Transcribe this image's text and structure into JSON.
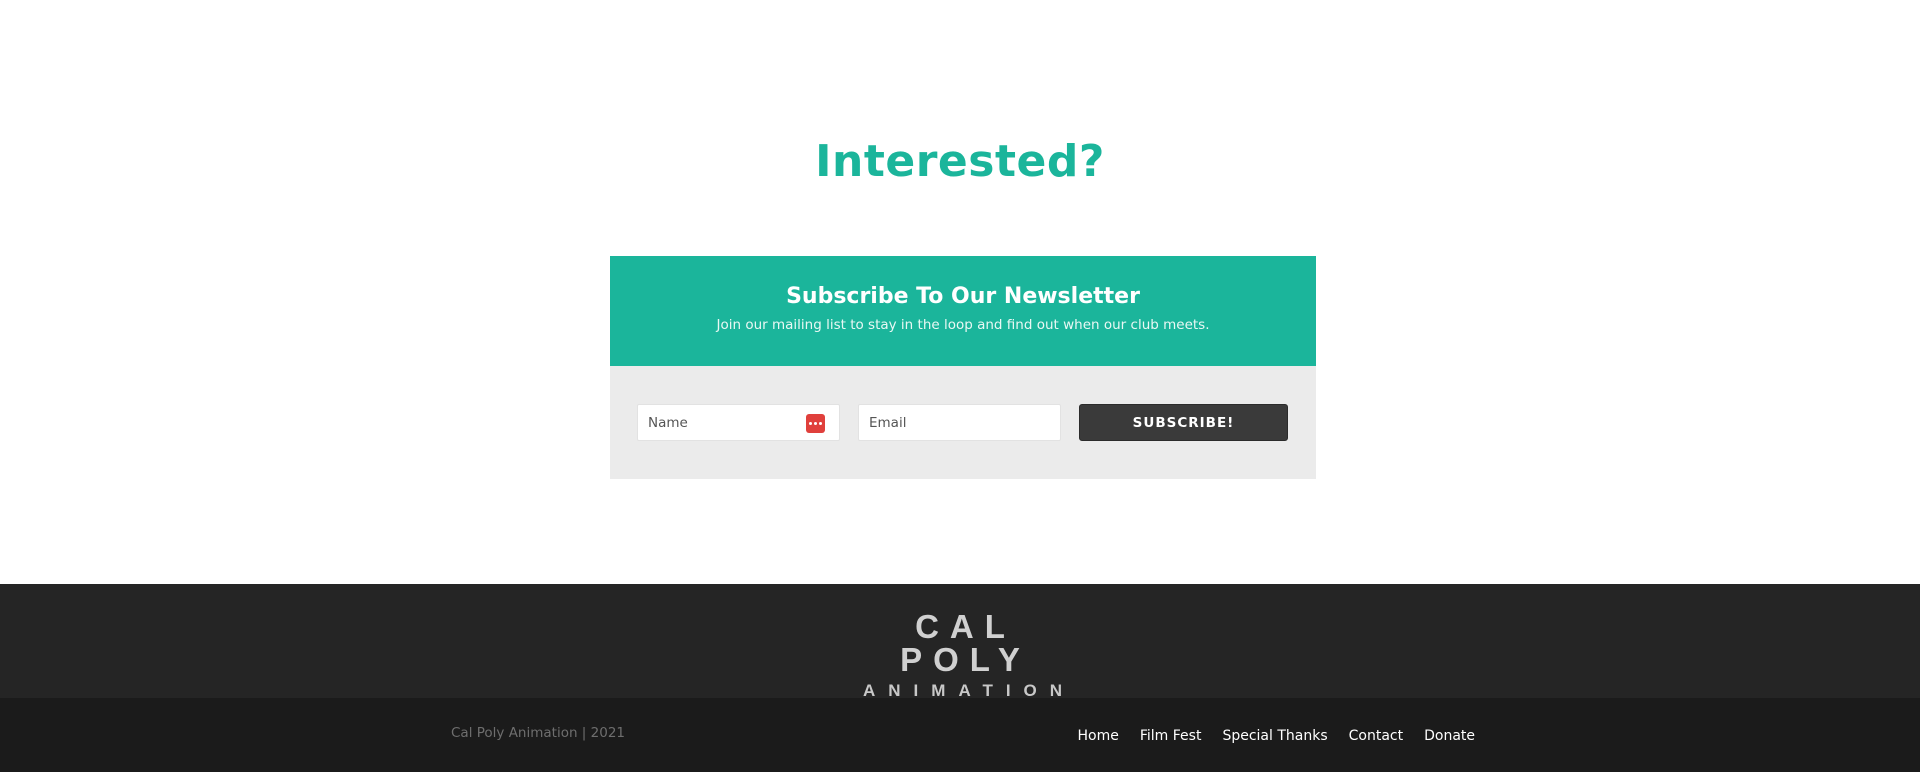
{
  "heading": "Interested?",
  "newsletter": {
    "title": "Subscribe To Our Newsletter",
    "description": "Join our mailing list to stay in the loop and find out when our club meets.",
    "name_placeholder": "Name",
    "email_placeholder": "Email",
    "subscribe_label": "SUBSCRIBE!",
    "name_field_icon": "password-manager-icon"
  },
  "footer": {
    "logo_line1": "CAL POLY",
    "logo_line2": "ANIMATION",
    "copyright": "Cal Poly Animation | 2021",
    "nav": [
      "Home",
      "Film Fest",
      "Special Thanks",
      "Contact",
      "Donate"
    ]
  },
  "colors": {
    "accent": "#1bb59b",
    "form_bg": "#ebebeb",
    "button_bg": "#3a3a3a",
    "footer_top_bg": "#252525",
    "footer_bottom_bg": "#1b1b1b",
    "icon_red": "#e0403c"
  }
}
